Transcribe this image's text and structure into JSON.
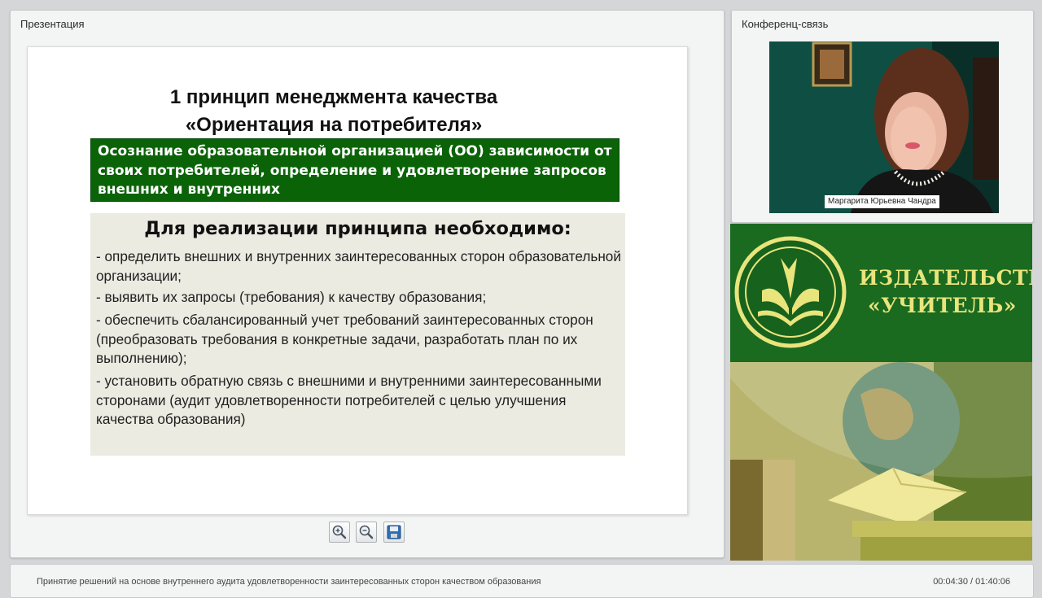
{
  "presentation": {
    "panel_title": "Презентация",
    "slide": {
      "title_line1": "1 принцип менеджмента качества",
      "title_line2": "«Ориентация на потребителя»",
      "green_box_text": "Осознание образовательной организацией (ОО) зависимости от своих потребителей, определение и удовлетворение запросов внешних и внутренних",
      "section_heading": "Для реализации принципа необходимо:",
      "bullets": [
        "- определить внешних и внутренних заинтересованных сторон образовательной организации;",
        "- выявить их запросы (требования) к качеству образования;",
        "- обеспечить сбалансированный учет требований заинтересованных сторон (преобразовать требования в конкретные задачи, разработать план по их выполнению);",
        "- установить обратную связь с внешними и внутренними заинтересованными сторонами (аудит удовлетворенности потребителей с целью улучшения качества образования)"
      ]
    },
    "toolbar": {
      "zoom_in_icon": "zoom-in-icon",
      "zoom_out_icon": "zoom-out-icon",
      "save_icon": "save-icon"
    }
  },
  "conference": {
    "panel_title": "Конференц-связь",
    "speaker_name": "Маргарита Юрьевна Чандра"
  },
  "publisher": {
    "name_line1": "ИЗДАТЕЛЬСТВО",
    "name_line2": "«УЧИТЕЛЬ»",
    "brand_color": "#1a6a20",
    "accent_color": "#e9e47c"
  },
  "status_bar": {
    "lecture_title": "Принятие решений на основе внутреннего аудита удовлетворенности заинтересованных сторон качеством образования",
    "time": "00:04:30 / 01:40:06"
  }
}
